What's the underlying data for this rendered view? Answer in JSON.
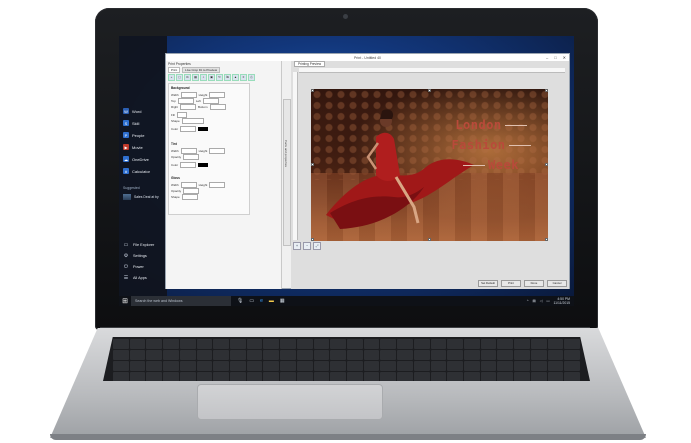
{
  "start_menu": {
    "items": [
      {
        "label": "Word",
        "icon": "word-icon",
        "color": "#2b5fb3"
      },
      {
        "label": "Skill",
        "icon": "skill-icon",
        "color": "#2d6fcf"
      },
      {
        "label": "People",
        "icon": "people-icon",
        "color": "#2f6fd0"
      },
      {
        "label": "Movie",
        "icon": "movie-icon",
        "color": "#c0392b"
      },
      {
        "label": "OneDrive",
        "icon": "onedrive-icon",
        "color": "#2f6fd0"
      },
      {
        "label": "Calculator",
        "icon": "calculator-icon",
        "color": "#2f6fd0"
      }
    ],
    "suggested_label": "Suggested",
    "suggested_item": "Sales Deal at by",
    "system": [
      {
        "label": "File Explorer",
        "icon": "folder-icon"
      },
      {
        "label": "Settings",
        "icon": "gear-icon"
      },
      {
        "label": "Power",
        "icon": "power-icon"
      },
      {
        "label": "All Apps",
        "icon": "apps-icon"
      }
    ]
  },
  "taskbar": {
    "search_placeholder": "Search the web and Windows",
    "time": "4:50 PM",
    "date": "11/11/2015"
  },
  "app": {
    "title": "Print - Untitled 40",
    "props_title": "Print Properties",
    "tabs": [
      "Print",
      "Live Crop Fit to Preview"
    ],
    "sections": [
      "Background",
      "Tint",
      "Gloss"
    ],
    "fields": [
      "Width",
      "Height",
      "Top",
      "Left",
      "Right",
      "Bottom",
      "Fill",
      "Color",
      "Shape",
      "Opacity"
    ],
    "splitter_label": "Parts and properties",
    "preview_tab": "Printing Preview",
    "buttons": [
      "Set Default",
      "Print",
      "Done",
      "Cancel"
    ]
  },
  "image": {
    "lines": [
      "London",
      "Fashion",
      "Week"
    ]
  },
  "colors": {
    "accent_text": "#b94a3a",
    "dress": "#a01818"
  }
}
